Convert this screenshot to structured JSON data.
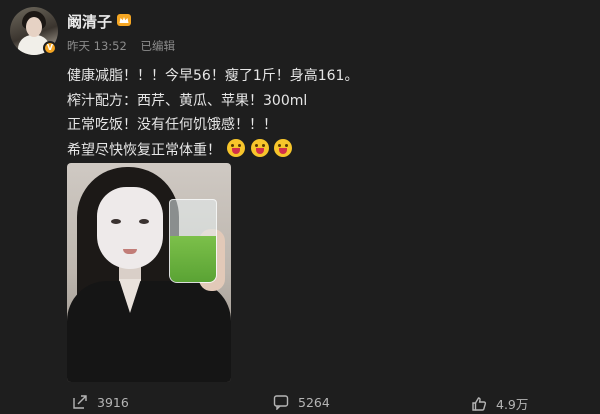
{
  "post": {
    "username": "阚清子",
    "time": "昨天 13:52",
    "edited": "已编辑",
    "avatar_badge": "V",
    "content_lines": [
      "健康减脂！！！今早56！瘦了1斤！身高161。",
      "榨汁配方：西芹、黄瓜、苹果！300ml",
      "正常吃饭！没有任何饥饿感！！！",
      "希望尽快恢复正常体重！"
    ],
    "emojis": [
      "tongue-face-emoji",
      "tongue-face-emoji",
      "tongue-face-emoji"
    ]
  },
  "actions": {
    "share_count": "3916",
    "comment_count": "5264",
    "like_count": "4.9万"
  },
  "colors": {
    "background": "#1e1e1e",
    "text": "#e6e6e6",
    "muted": "#8c8c8c",
    "badge": "#f5a623"
  }
}
